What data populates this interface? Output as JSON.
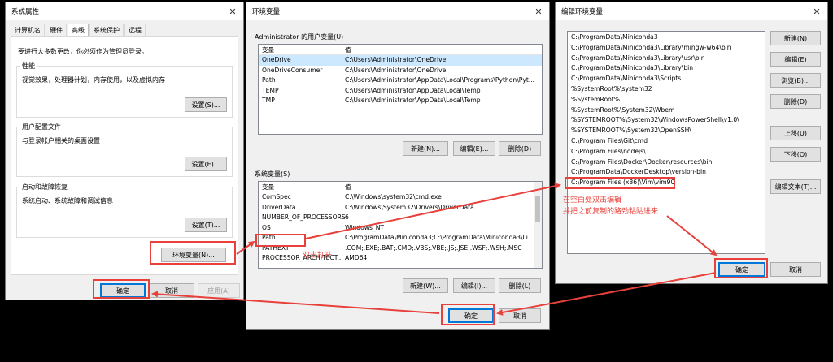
{
  "sys_props": {
    "title": "系统属性",
    "close": "✕",
    "tabs": [
      "计算机名",
      "硬件",
      "高级",
      "系统保护",
      "远程"
    ],
    "admin_note": "要进行大多数更改，你必须作为管理员登录。",
    "perf_group": "性能",
    "perf_desc": "视觉效果，处理器计划，内存使用，以及虚拟内存",
    "perf_btn": "设置(S)...",
    "profile_group": "用户配置文件",
    "profile_desc": "与登录帐户相关的桌面设置",
    "profile_btn": "设置(E)...",
    "startup_group": "启动和故障恢复",
    "startup_desc": "系统启动、系统故障和调试信息",
    "startup_btn": "设置(T)...",
    "env_btn": "环境变量(N)...",
    "ok": "确定",
    "cancel": "取消",
    "apply": "应用(A)"
  },
  "env_vars": {
    "title": "环境变量",
    "close": "✕",
    "user_group": "Administrator 的用户变量(U)",
    "col_var": "变量",
    "col_val": "值",
    "user_rows": [
      {
        "name": "OneDrive",
        "value": "C:\\Users\\Administrator\\OneDrive"
      },
      {
        "name": "OneDriveConsumer",
        "value": "C:\\Users\\Administrator\\OneDrive"
      },
      {
        "name": "Path",
        "value": "C:\\Users\\Administrator\\AppData\\Local\\Programs\\Python\\Pyt..."
      },
      {
        "name": "TEMP",
        "value": "C:\\Users\\Administrator\\AppData\\Local\\Temp"
      },
      {
        "name": "TMP",
        "value": "C:\\Users\\Administrator\\AppData\\Local\\Temp"
      }
    ],
    "user_new": "新建(N)...",
    "user_edit": "编辑(E)...",
    "user_delete": "删除(D)",
    "sys_group": "系统变量(S)",
    "sys_rows": [
      {
        "name": "ComSpec",
        "value": "C:\\Windows\\system32\\cmd.exe"
      },
      {
        "name": "DriverData",
        "value": "C:\\Windows\\System32\\Drivers\\DriverData"
      },
      {
        "name": "NUMBER_OF_PROCESSORS",
        "value": "6"
      },
      {
        "name": "OS",
        "value": "Windows_NT"
      },
      {
        "name": "Path",
        "value": "C:\\ProgramData\\Miniconda3;C:\\ProgramData\\Miniconda3\\Li..."
      },
      {
        "name": "PATHEXT",
        "value": ".COM;.EXE;.BAT;.CMD;.VBS;.VBE;.JS;.JSE;.WSF;.WSH;.MSC"
      },
      {
        "name": "PROCESSOR_ARCHITECT...",
        "value": "AMD64"
      }
    ],
    "sys_new": "新建(W)...",
    "sys_edit": "编辑(I)...",
    "sys_delete": "删除(L)",
    "ok": "确定",
    "cancel": "取消"
  },
  "edit_env": {
    "title": "编辑环境变量",
    "close": "✕",
    "paths": [
      "C:\\ProgramData\\Miniconda3",
      "C:\\ProgramData\\Miniconda3\\Library\\mingw-w64\\bin",
      "C:\\ProgramData\\Miniconda3\\Library\\usr\\bin",
      "C:\\ProgramData\\Miniconda3\\Library\\bin",
      "C:\\ProgramData\\Miniconda3\\Scripts",
      "%SystemRoot%\\system32",
      "%SystemRoot%",
      "%SystemRoot%\\System32\\Wbem",
      "%SYSTEMROOT%\\System32\\WindowsPowerShell\\v1.0\\",
      "%SYSTEMROOT%\\System32\\OpenSSH\\",
      "C:\\Program Files\\Git\\cmd",
      "C:\\Program Files\\nodejs\\",
      "C:\\Program Files\\Docker\\Docker\\resources\\bin",
      "C:\\ProgramData\\DockerDesktop\\version-bin",
      "C:\\Program Files (x86)\\Vim\\vim90"
    ],
    "new": "新建(N)",
    "edit": "编辑(E)",
    "browse": "浏览(B)...",
    "delete": "删除(D)",
    "move_up": "上移(U)",
    "move_down": "下移(O)",
    "edit_text": "编辑文本(T)...",
    "ok": "确定",
    "cancel": "取消"
  },
  "annotations": {
    "double_click_open": "双击打开",
    "hint_line1": "在空白处双击编辑",
    "hint_line2": "并把之前复制的路劲粘贴进来"
  },
  "colors": {
    "annotation": "#e8413b",
    "selection": "#cce8ff",
    "accent": "#0078d7"
  }
}
